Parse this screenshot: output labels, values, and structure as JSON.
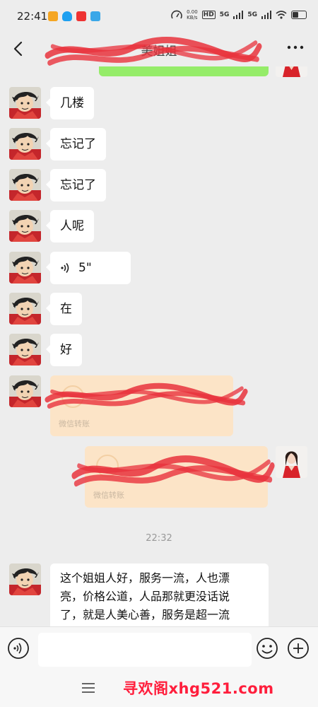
{
  "status_bar": {
    "time": "22:41",
    "net_speed_value": "0.00",
    "net_speed_unit": "KB/s",
    "hd_label": "HD",
    "sim1_label": "5G",
    "sim2_label": "5G"
  },
  "header": {
    "title": "美姐姐"
  },
  "messages": {
    "m1": "几楼",
    "m2": "忘记了",
    "m3": "忘记了",
    "m4": "人呢",
    "m5_duration": "5\"",
    "m6": "在",
    "m7": "好",
    "card1_sub": "微信转账",
    "card2_sub": "微信转账",
    "timestamp": "22:32",
    "long_line1": "这个姐姐人好，服务一流，人也漂",
    "long_line2": "亮，价格公道，人品那就更没话说",
    "long_line3": "了，就是人美心善，服务是超一流"
  },
  "bottom": {
    "watermark": "寻欢阁xhg521.com"
  },
  "colors": {
    "background": "#ededed",
    "green_bubble": "#95ec69",
    "transfer_card": "#fce4c7",
    "scribble": "#e8323c",
    "watermark": "#ff1e3c"
  },
  "icons": [
    "back-arrow-icon",
    "more-dots-icon",
    "voice-wave-icon",
    "voice-mode-icon",
    "emoji-icon",
    "plus-icon",
    "menu-icon"
  ]
}
